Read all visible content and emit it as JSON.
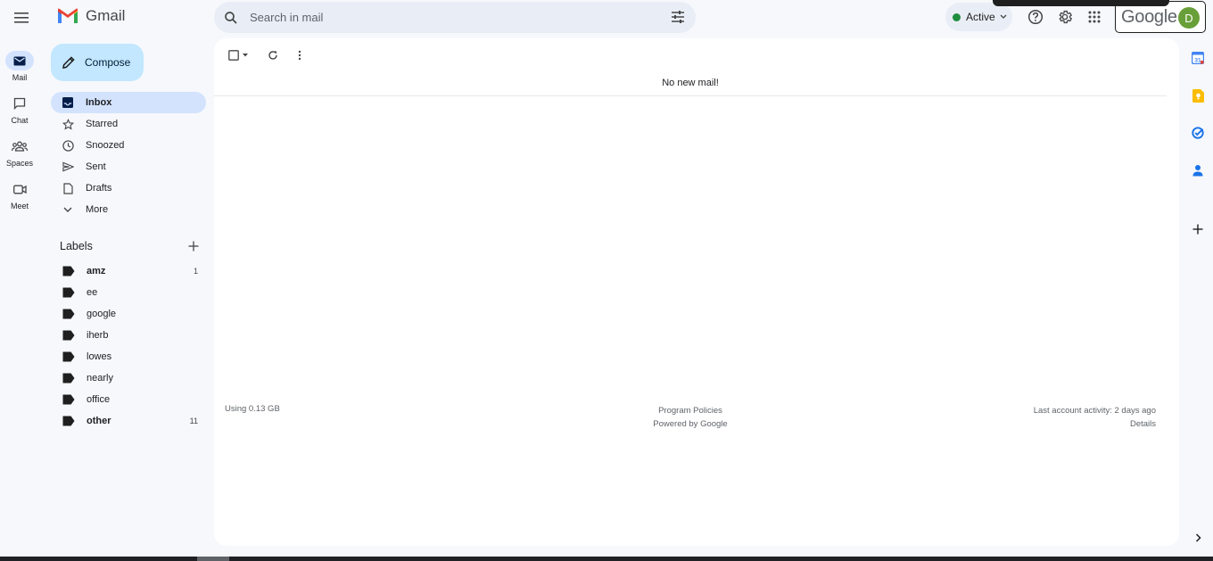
{
  "app": {
    "name": "Gmail",
    "brand_colors": {
      "accent": "#0b57d0",
      "compose_bg": "#c2e7ff",
      "active_bg": "#d3e3fd",
      "status_green": "#1e8e3e"
    }
  },
  "search": {
    "placeholder": "Search in mail"
  },
  "status": {
    "label": "Active"
  },
  "account": {
    "brand": "Google",
    "avatar_letter": "D",
    "avatar_color": "#689f38"
  },
  "rail": {
    "items": [
      {
        "label": "Mail",
        "icon": "mail-icon"
      },
      {
        "label": "Chat",
        "icon": "chat-icon"
      },
      {
        "label": "Spaces",
        "icon": "spaces-icon"
      },
      {
        "label": "Meet",
        "icon": "meet-icon"
      }
    ]
  },
  "compose": {
    "label": "Compose"
  },
  "nav": {
    "items": [
      {
        "label": "Inbox",
        "icon": "inbox-icon"
      },
      {
        "label": "Starred",
        "icon": "star-icon"
      },
      {
        "label": "Snoozed",
        "icon": "clock-icon"
      },
      {
        "label": "Sent",
        "icon": "send-icon"
      },
      {
        "label": "Drafts",
        "icon": "draft-icon"
      },
      {
        "label": "More",
        "icon": "chevron-down-icon"
      }
    ]
  },
  "labels": {
    "title": "Labels",
    "items": [
      {
        "name": "amz",
        "count": "1"
      },
      {
        "name": "ee",
        "count": ""
      },
      {
        "name": "google",
        "count": ""
      },
      {
        "name": "iherb",
        "count": ""
      },
      {
        "name": "lowes",
        "count": ""
      },
      {
        "name": "nearly",
        "count": ""
      },
      {
        "name": "office",
        "count": ""
      },
      {
        "name": "other",
        "count": "11"
      }
    ]
  },
  "main": {
    "empty_message": "No new mail!",
    "footer": {
      "storage": "Using 0.13 GB",
      "policies": "Program Policies",
      "powered": "Powered by Google",
      "activity": "Last account activity: 2 days ago",
      "details": "Details"
    }
  }
}
